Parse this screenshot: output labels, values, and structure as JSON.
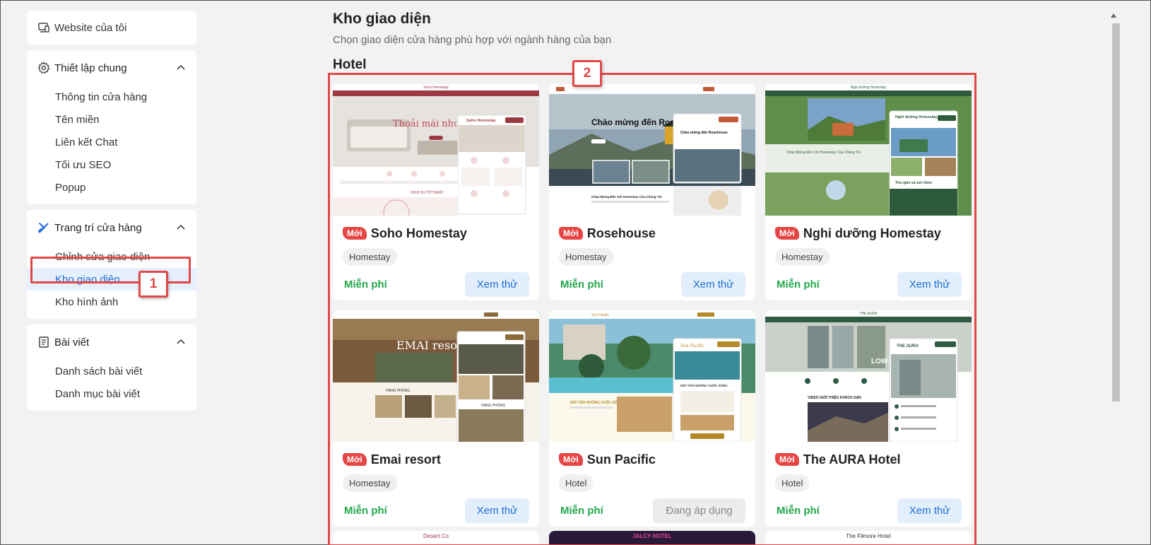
{
  "sidebar": {
    "my_website": {
      "label": "Website của tôi",
      "icon": "devices-icon"
    },
    "general": {
      "label": "Thiết lập chung",
      "icon": "gear-icon",
      "items": [
        "Thông tin cửa hàng",
        "Tên miền",
        "Liên kết Chat",
        "Tối ưu SEO",
        "Popup"
      ]
    },
    "decor": {
      "label": "Trang trí cửa hàng",
      "icon": "paint-brush-icon",
      "items": [
        "Chỉnh sửa giao diện",
        "Kho giao diện",
        "Kho hình ảnh"
      ],
      "active_index": 1
    },
    "posts": {
      "label": "Bài viết",
      "icon": "document-icon",
      "items": [
        "Danh sách bài viết",
        "Danh mục bài viết"
      ]
    }
  },
  "annotations": {
    "callout_1": "1",
    "callout_2": "2",
    "color": "#e14848"
  },
  "main": {
    "title": "Kho giao diện",
    "subtitle": "Chọn giao diện cửa hàng phù hợp với ngành hàng của bạn",
    "section": "Hotel"
  },
  "templates": [
    {
      "badge": "Mới",
      "name": "Soho Homestay",
      "tag": "Homestay",
      "price": "Miễn phí",
      "action": "Xem thử",
      "applied": false,
      "thumb": {
        "theme": "#9c3a43",
        "hero_text": "Thoải mái như ở",
        "header_text": "Soho Homestay",
        "popup_title": "Soho Homestay",
        "mid_text": "DỊCH VỤ TỐT NHẤT"
      }
    },
    {
      "badge": "Mới",
      "name": "Rosehouse",
      "tag": "Homestay",
      "price": "Miễn phí",
      "action": "Xem thử",
      "applied": false,
      "thumb": {
        "theme": "#c25a3a",
        "hero_text": "Chào mừng đến Rosehouse",
        "popup_title": "Chào mừng đến Rosehouse",
        "mid_text": "Chào Mừng Đến Với Homestay Của Chúng Tôi"
      }
    },
    {
      "badge": "Mới",
      "name": "Nghi dưỡng Homestay",
      "tag": "Homestay",
      "price": "Miễn phí",
      "action": "Xem thử",
      "applied": false,
      "thumb": {
        "theme": "#2d5b3a",
        "header_text": "Nghi dưỡng Homestay",
        "popup_title": "Nghỉ dưỡng Homestay",
        "mid_text": "Thư giãn và sức khỏe"
      }
    },
    {
      "badge": "Mới",
      "name": "Emai resort",
      "tag": "Homestay",
      "price": "Miễn phí",
      "action": "Xem thử",
      "applied": false,
      "thumb": {
        "theme": "#8a6a3a",
        "hero_text": "EMAI resort",
        "mid_text": "HẠNG PHÒNG"
      }
    },
    {
      "badge": "Mới",
      "name": "Sun Pacific",
      "tag": "Hotel",
      "price": "Miễn phí",
      "action": "Đang áp dụng",
      "applied": true,
      "thumb": {
        "theme": "#b58a2a",
        "header_text": "Sun Pacific",
        "popup_title": "Sun Pacific",
        "mid_text": "NƠI TẬN HƯỞNG CUỘC SỐNG"
      }
    },
    {
      "badge": "Mới",
      "name": "The AURA Hotel",
      "tag": "Hotel",
      "price": "Miễn phí",
      "action": "Xem thử",
      "applied": false,
      "thumb": {
        "theme": "#2f5a44",
        "header_text": "THE AURA",
        "popup_title": "THE AURA",
        "mid_text": "VIDEO GIỚI THIỆU KHÁCH SẠN"
      }
    }
  ],
  "row3_headers": [
    "Desert Co",
    "JALCY HOTEL",
    "The Filmore Hotel"
  ]
}
